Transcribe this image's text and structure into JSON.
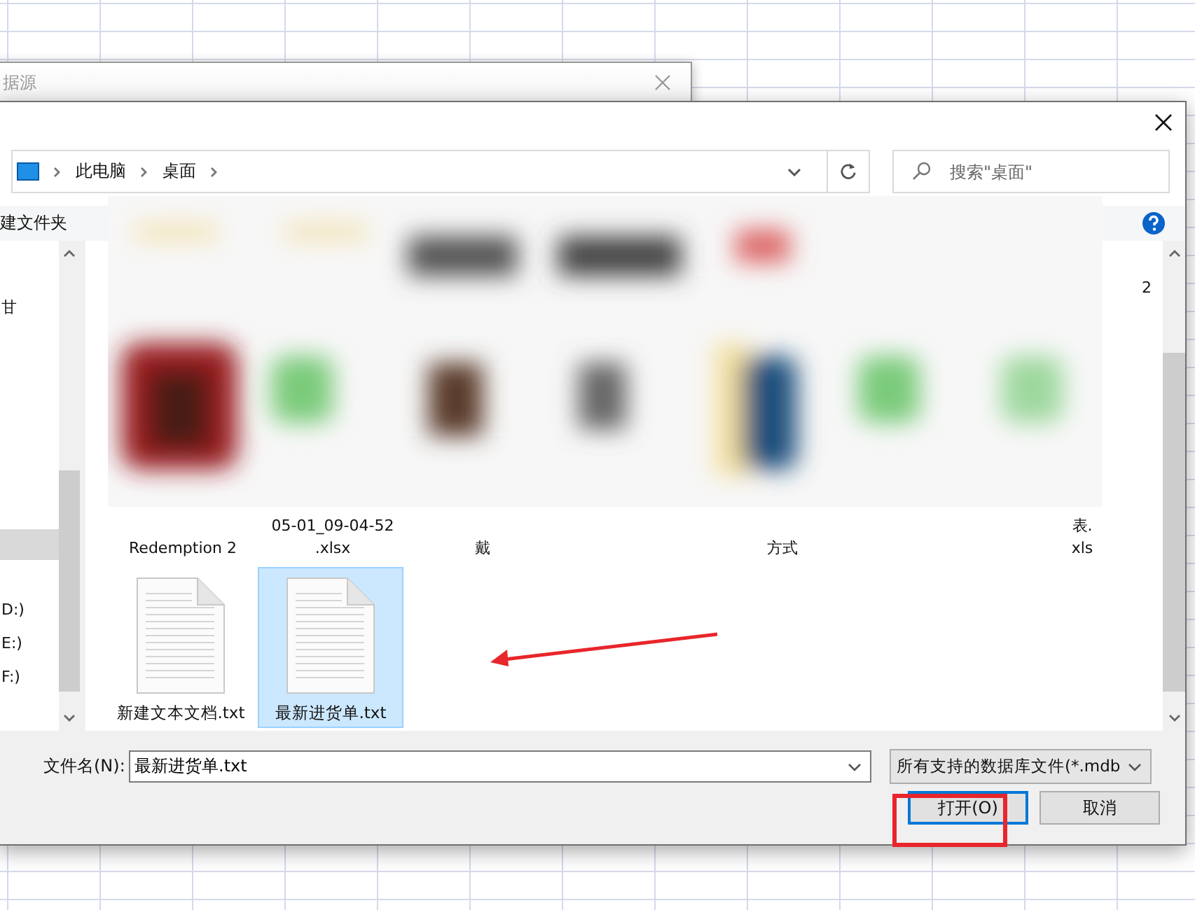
{
  "background_window": {
    "title": "据源"
  },
  "address_bar": {
    "crumbs": [
      "此电脑",
      "桌面"
    ]
  },
  "search": {
    "placeholder": "搜索\"桌面\""
  },
  "toolbar": {
    "new_folder": "建文件夹"
  },
  "nav_pane": {
    "items": [
      {
        "label": "甘",
        "selected": false
      },
      {
        "selected": true
      },
      {
        "label": "D:)",
        "selected": false
      },
      {
        "label": "E:)",
        "selected": false
      },
      {
        "label": "F:)",
        "selected": false
      }
    ]
  },
  "partial_labels": {
    "first_row": [
      {
        "lines": [
          "2"
        ]
      }
    ],
    "second_row": [
      {
        "lines": [
          "Redemption 2"
        ]
      },
      {
        "lines": [
          "05-01_09-04-52",
          ".xlsx"
        ]
      },
      {
        "lines": [
          "戴"
        ]
      },
      {
        "lines": [
          "方式"
        ]
      },
      {
        "lines": [
          "表.",
          "xls"
        ]
      }
    ]
  },
  "files": [
    {
      "name": "新建文本文档.txt",
      "selected": false
    },
    {
      "name": "最新进货单.txt",
      "selected": true
    }
  ],
  "file_name": {
    "label": "文件名(N):",
    "value": "最新进货单.txt"
  },
  "file_type": {
    "value": "所有支持的数据库文件(*.mdb"
  },
  "buttons": [
    {
      "label": "打开(O)",
      "kind": "primary"
    },
    {
      "label": "取消",
      "kind": "normal"
    }
  ]
}
